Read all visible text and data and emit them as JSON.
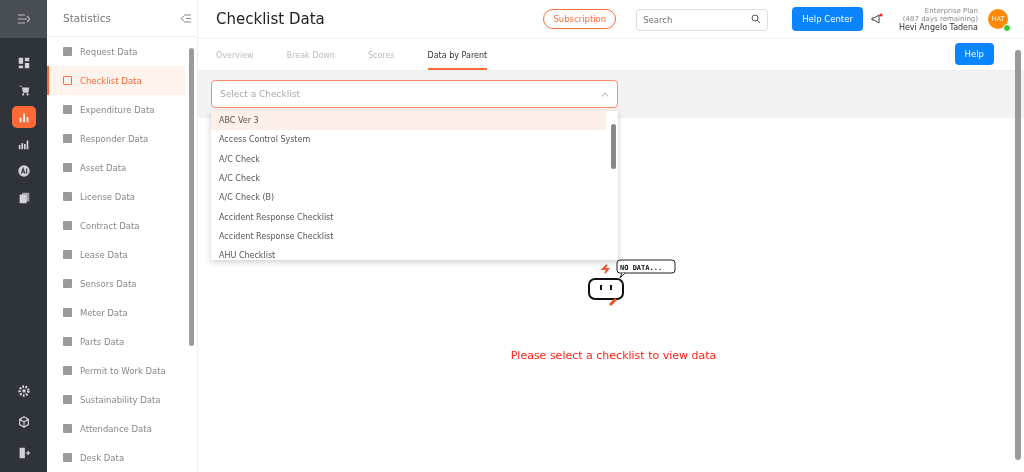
{
  "rail": {
    "top": [
      {
        "kind": "grid",
        "selected": false
      },
      {
        "kind": "cart",
        "selected": false
      },
      {
        "kind": "chart",
        "selected": true
      },
      {
        "kind": "bars",
        "selected": false
      },
      {
        "kind": "ai",
        "selected": false
      },
      {
        "kind": "docs",
        "selected": false
      }
    ],
    "bottom": [
      {
        "kind": "gear"
      },
      {
        "kind": "cube"
      },
      {
        "kind": "exit"
      }
    ]
  },
  "sidebar": {
    "title": "Statistics",
    "items": [
      {
        "label": "Request Data",
        "selected": false
      },
      {
        "label": "Checklist Data",
        "selected": true
      },
      {
        "label": "Expenditure Data",
        "selected": false
      },
      {
        "label": "Responder Data",
        "selected": false
      },
      {
        "label": "Asset Data",
        "selected": false
      },
      {
        "label": "License Data",
        "selected": false
      },
      {
        "label": "Contract Data",
        "selected": false
      },
      {
        "label": "Lease Data",
        "selected": false
      },
      {
        "label": "Sensors Data",
        "selected": false
      },
      {
        "label": "Meter Data",
        "selected": false
      },
      {
        "label": "Parts Data",
        "selected": false
      },
      {
        "label": "Permit to Work Data",
        "selected": false
      },
      {
        "label": "Sustainability Data",
        "selected": false
      },
      {
        "label": "Attendance Data",
        "selected": false
      },
      {
        "label": "Desk Data",
        "selected": false
      }
    ]
  },
  "header": {
    "title": "Checklist Data",
    "subscription": "Subscription",
    "search": {
      "placeholder": "Search"
    },
    "help_center": "Help Center",
    "plan": "Enterprise Plan",
    "days": "(487 days remaining)",
    "user": "Hevi Angelo Tadena",
    "avatar": "HAT"
  },
  "tabs": [
    {
      "label": "Overview",
      "selected": false
    },
    {
      "label": "Break Down",
      "selected": false
    },
    {
      "label": "Scores",
      "selected": false
    },
    {
      "label": "Data by Parent",
      "selected": true
    }
  ],
  "help_button": "Help",
  "select": {
    "placeholder": "Select a Checklist",
    "expanded": true,
    "options": [
      {
        "label": "ABC Ver 3",
        "selected": true
      },
      {
        "label": "Access Control System",
        "selected": false
      },
      {
        "label": "A/C Check",
        "selected": false
      },
      {
        "label": "A/C Check",
        "selected": false
      },
      {
        "label": "A/C Check (B)",
        "selected": false
      },
      {
        "label": "Accident Response Checklist",
        "selected": false
      },
      {
        "label": "Accident Response Checklist",
        "selected": false
      },
      {
        "label": "AHU Checklist",
        "selected": false
      }
    ]
  },
  "empty_state": {
    "bubble": "NO DATA...",
    "message": "Please select a checklist to view data"
  }
}
